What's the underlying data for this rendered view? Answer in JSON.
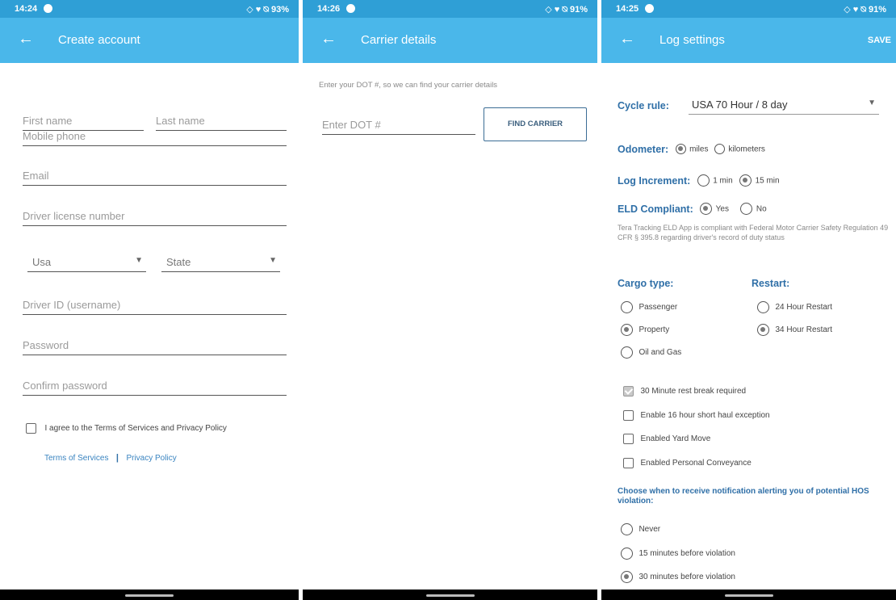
{
  "screen1": {
    "status": {
      "time": "14:24",
      "right": "◇ ♥ ⍉ 93%"
    },
    "title": "Create account",
    "first_name": "First name",
    "last_name": "Last name",
    "mobile_phone": "Mobile phone",
    "email": "Email",
    "driver_license": "Driver license number",
    "country": "Usa",
    "state": "State",
    "driver_id": "Driver ID (username)",
    "password": "Password",
    "confirm_password": "Confirm password",
    "agree": "I agree to the Terms of Services and Privacy Policy",
    "terms_link": "Terms of Services",
    "link_sep": "|",
    "privacy_link": "Privacy Policy"
  },
  "screen2": {
    "status": {
      "time": "14:26",
      "right": "◇ ♥ ⍉ 91%"
    },
    "title": "Carrier details",
    "instruction": "Enter your DOT #, so we can find your carrier details",
    "dot_placeholder": "Enter DOT #",
    "find_button": "FIND CARRIER"
  },
  "screen3": {
    "status": {
      "time": "14:25",
      "right": "◇ ♥ ⍉ 91%"
    },
    "title": "Log settings",
    "save": "SAVE",
    "cycle_label": "Cycle rule:",
    "cycle_value": "USA 70 Hour / 8 day",
    "odometer_label": "Odometer:",
    "odo_miles": "miles",
    "odo_km": "kilometers",
    "increment_label": "Log Increment:",
    "inc_1": "1 min",
    "inc_15": "15 min",
    "eld_label": "ELD Compliant:",
    "eld_yes": "Yes",
    "eld_no": "No",
    "eld_note": "Tera Tracking ELD App is compliant with Federal Motor Carrier Safety Regulation 49 CFR § 395.8 regarding driver's record of duty status",
    "cargo_label": "Cargo type:",
    "cargo_passenger": "Passenger",
    "cargo_property": "Property",
    "cargo_oil": "Oil and Gas",
    "restart_label": "Restart:",
    "restart_24": "24 Hour Restart",
    "restart_34": "34 Hour Restart",
    "chk_break": "30 Minute rest break required",
    "chk_shorthaul": "Enable 16 hour short haul exception",
    "chk_yard": "Enabled Yard Move",
    "chk_personal": "Enabled Personal Conveyance",
    "notify_label": "Choose when to receive notification alerting you of potential HOS violation:",
    "notify_never": "Never",
    "notify_15": "15 minutes before violation",
    "notify_30": "30 minutes before violation"
  },
  "colors": {
    "status_bar": "#2f9fd6",
    "app_bar": "#4ab7ea",
    "accent_text": "#2f6fa7"
  }
}
